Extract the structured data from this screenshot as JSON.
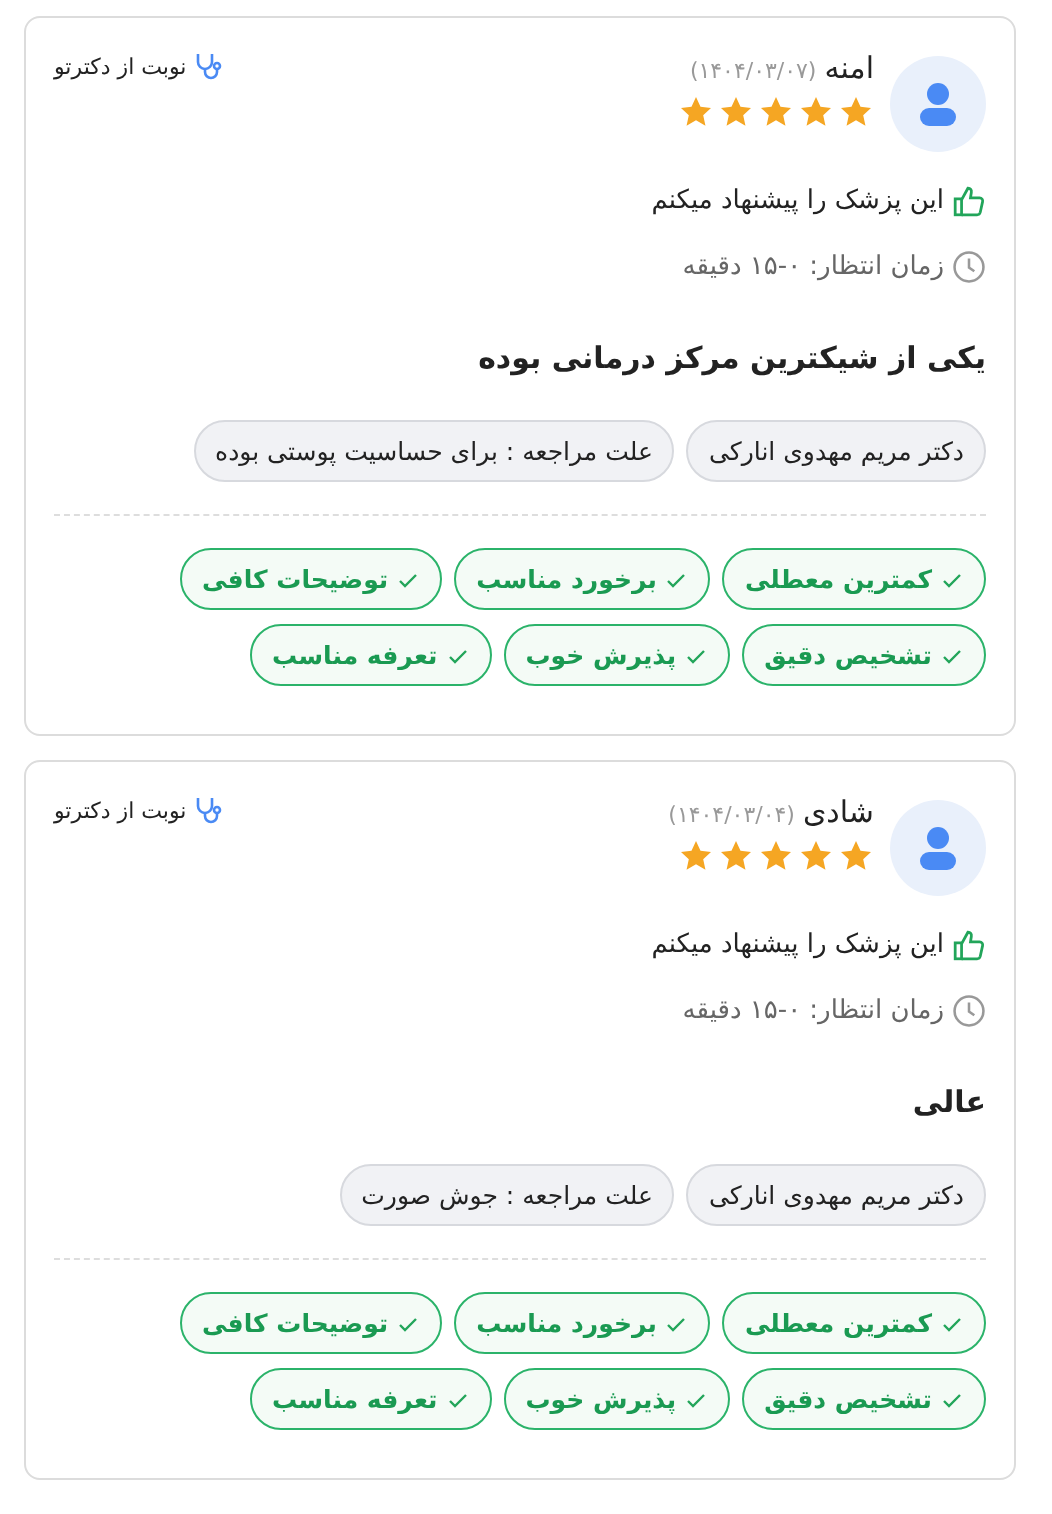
{
  "reviews": [
    {
      "name": "امنه",
      "date": "(۱۴۰۴/۰۳/۰۷)",
      "stars": 5,
      "source": "نوبت از دکترتو",
      "recommendation": "این پزشک را پیشنهاد میکنم",
      "wait_time": "زمان انتظار: ۰-۱۵ دقیقه",
      "comment": "یکی از شیکترین مرکز درمانی بوده",
      "tags": [
        "دکتر مریم مهدوی انارکی",
        "علت مراجعه : برای حساسیت پوستی بوده"
      ],
      "qualities": [
        "کمترین معطلی",
        "برخورد مناسب",
        "توضیحات کافی",
        "تشخیص دقیق",
        "پذیرش خوب",
        "تعرفه مناسب"
      ]
    },
    {
      "name": "شادی",
      "date": "(۱۴۰۴/۰۳/۰۴)",
      "stars": 5,
      "source": "نوبت از دکترتو",
      "recommendation": "این پزشک را پیشنهاد میکنم",
      "wait_time": "زمان انتظار: ۰-۱۵ دقیقه",
      "comment": "عالی",
      "tags": [
        "دکتر مریم مهدوی انارکی",
        "علت مراجعه : جوش صورت"
      ],
      "qualities": [
        "کمترین معطلی",
        "برخورد مناسب",
        "توضیحات کافی",
        "تشخیص دقیق",
        "پذیرش خوب",
        "تعرفه مناسب"
      ]
    }
  ]
}
